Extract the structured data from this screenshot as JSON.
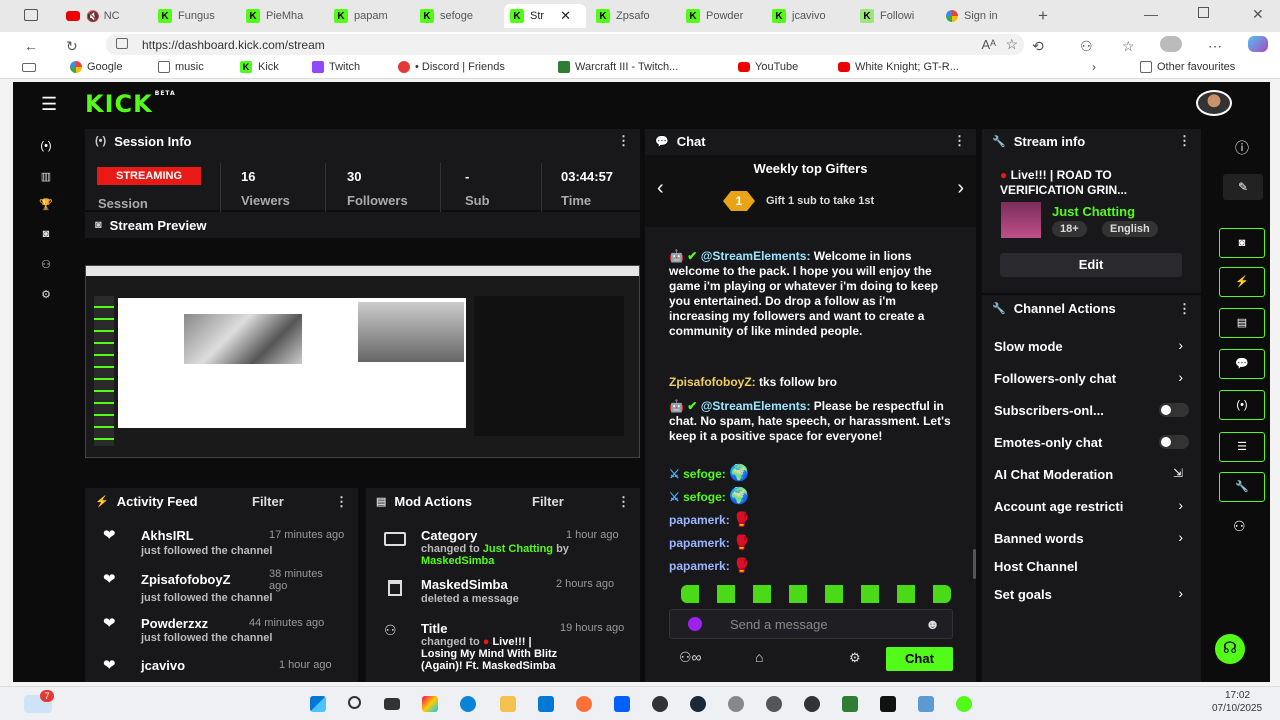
{
  "browser": {
    "tabs": [
      {
        "label": "NC",
        "active": false
      },
      {
        "label": "Fungus",
        "active": false
      },
      {
        "label": "PieMha",
        "active": false
      },
      {
        "label": "papam",
        "active": false
      },
      {
        "label": "sefoge",
        "active": false
      },
      {
        "label": "Str",
        "active": true
      },
      {
        "label": "Zpsafo",
        "active": false
      },
      {
        "label": "Powder",
        "active": false
      },
      {
        "label": "jcavivo",
        "active": false
      },
      {
        "label": "Followi",
        "active": false
      },
      {
        "label": "Sign in",
        "active": false
      }
    ],
    "url": "https://dashboard.kick.com/stream",
    "bookmarks": [
      "Google",
      "music",
      "Kick",
      "Twitch",
      "• Discord | Friends",
      "Warcraft III - Twitch...",
      "YouTube",
      "White Knight; GT-R...",
      "Other favourites"
    ]
  },
  "app": {
    "logo": "KICK",
    "logo_badge": "BETA"
  },
  "session": {
    "title": "Session Info",
    "status": "STREAMING",
    "status_label": "Session",
    "viewers": "16",
    "viewers_label": "Viewers",
    "followers": "30",
    "followers_label": "Followers",
    "sub": "-",
    "sub_label": "Sub",
    "time": "03:44:57",
    "time_label": "Time"
  },
  "preview": {
    "title": "Stream Preview"
  },
  "activity": {
    "title": "Activity Feed",
    "filter": "Filter",
    "items": [
      {
        "name": "AkhsIRL",
        "time": "17 minutes ago",
        "text": "just followed the channel"
      },
      {
        "name": "ZpisafofoboyZ",
        "time": "38 minutes ago",
        "text": "just followed the channel"
      },
      {
        "name": "Powderzxz",
        "time": "44 minutes ago",
        "text": "just followed the channel"
      },
      {
        "name": "jcavivo",
        "time": "1 hour ago",
        "text": ""
      }
    ]
  },
  "mod": {
    "title": "Mod Actions",
    "filter": "Filter",
    "items": [
      {
        "name": "Category",
        "time": "1 hour ago",
        "line1": "changed to",
        "highlight": "Just Chatting",
        "by": "by",
        "user": "MaskedSimba"
      },
      {
        "name": "MaskedSimba",
        "time": "2 hours ago",
        "line1": "deleted a message"
      },
      {
        "name": "Title",
        "time": "19 hours ago",
        "line1": "changed to",
        "text2": "Live!!! |",
        "text3": "Losing My Mind With Blitz",
        "text4": "(Again)! Ft. MaskedSimba"
      }
    ]
  },
  "chat": {
    "title": "Chat",
    "gifters_title": "Weekly top Gifters",
    "gift_rank": "1",
    "gift_text": "Gift 1 sub to take 1st",
    "messages": [
      {
        "user": "@StreamElements:",
        "text": "Welcome in lions welcome to the pack. I hope you will enjoy the game i'm playing or whatever i'm doing to keep you entertained. Do drop a follow as i'm increasing my followers and want to create a community of like minded people."
      },
      {
        "user": "ZpisafofoboyZ:",
        "text": "tks follow bro"
      },
      {
        "user": "@StreamElements:",
        "text": "Please be respectful in chat. No spam, hate speech, or harassment. Let's keep it a positive space for everyone!"
      },
      {
        "user": "sefoge:",
        "text": ""
      },
      {
        "user": "sefoge:",
        "text": ""
      },
      {
        "user": "papamerk:",
        "text": ""
      },
      {
        "user": "papamerk:",
        "text": ""
      },
      {
        "user": "papamerk:",
        "text": ""
      }
    ],
    "placeholder": "Send a message",
    "send": "Chat"
  },
  "stream_info": {
    "title": "Stream info",
    "stream_title": "Live!!! | ROAD TO VERIFICATION GRIN...",
    "category": "Just Chatting",
    "tag1": "18+",
    "tag2": "English",
    "edit": "Edit"
  },
  "channel_actions": {
    "title": "Channel Actions",
    "items": [
      {
        "label": "Slow mode",
        "control": "arrow"
      },
      {
        "label": "Followers-only chat",
        "control": "arrow"
      },
      {
        "label": "Subscribers-onl...",
        "control": "toggle"
      },
      {
        "label": "Emotes-only chat",
        "control": "toggle"
      },
      {
        "label": "AI Chat Moderation",
        "control": "external"
      },
      {
        "label": "Account age restricti",
        "control": "arrow"
      },
      {
        "label": "Banned words",
        "control": "arrow"
      },
      {
        "label": "Host Channel",
        "control": "none"
      },
      {
        "label": "Set goals",
        "control": "arrow"
      }
    ]
  },
  "taskbar": {
    "badge": "7",
    "time": "17:02",
    "date": "07/10/2025"
  },
  "colors": {
    "accent": "#53fc18",
    "live": "#e91916",
    "panel": "#18181b"
  }
}
